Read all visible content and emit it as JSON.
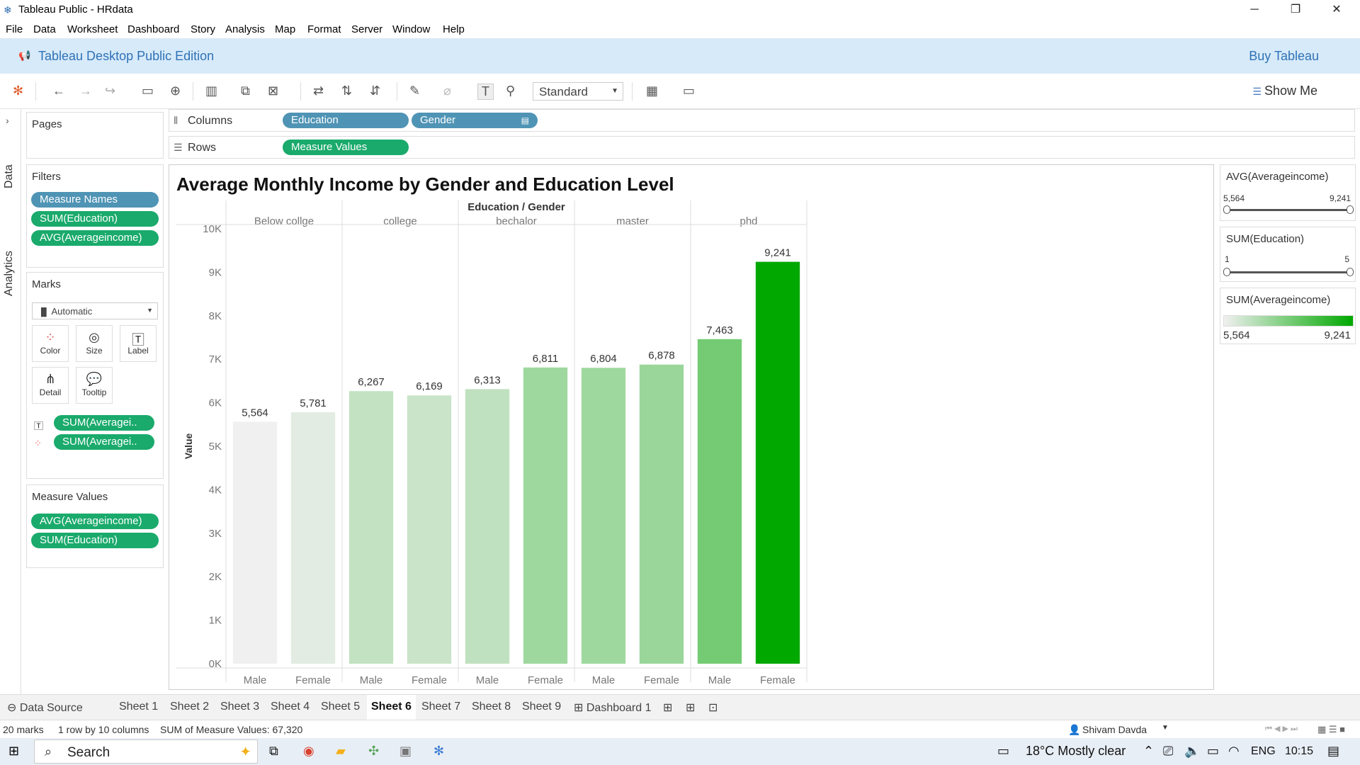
{
  "window": {
    "title": "Tableau Public - HRdata"
  },
  "menu": [
    "File",
    "Data",
    "Worksheet",
    "Dashboard",
    "Story",
    "Analysis",
    "Map",
    "Format",
    "Server",
    "Window",
    "Help"
  ],
  "banner": {
    "edition": "Tableau Desktop Public Edition",
    "buy": "Buy Tableau"
  },
  "toolbar": {
    "fit": "Standard",
    "show_me": "Show Me"
  },
  "left_tabs": {
    "data": "Data",
    "analytics": "Analytics"
  },
  "pages": {
    "header": "Pages"
  },
  "filters": {
    "header": "Filters",
    "items": [
      "Measure Names",
      "SUM(Education)",
      "AVG(Averageincome)"
    ]
  },
  "marks": {
    "header": "Marks",
    "type": "Automatic",
    "cards": {
      "color": "Color",
      "size": "Size",
      "label": "Label",
      "detail": "Detail",
      "tooltip": "Tooltip"
    },
    "fields": [
      "SUM(Averagei..",
      "SUM(Averagei.."
    ]
  },
  "measure_values": {
    "header": "Measure Values",
    "items": [
      "AVG(Averageincome)",
      "SUM(Education)"
    ]
  },
  "shelves": {
    "columns_label": "Columns",
    "columns": [
      "Education",
      "Gender"
    ],
    "rows_label": "Rows",
    "rows": [
      "Measure Values"
    ]
  },
  "chart_data": {
    "type": "bar",
    "title": "Average Monthly Income by Gender and Education Level",
    "header": "Education / Gender",
    "ylabel": "Value",
    "ylim": [
      0,
      10000
    ],
    "yticks": [
      "0K",
      "1K",
      "2K",
      "3K",
      "4K",
      "5K",
      "6K",
      "7K",
      "8K",
      "9K",
      "10K"
    ],
    "groups": [
      "Below collge",
      "college",
      "bechalor",
      "master",
      "phd"
    ],
    "categories": [
      "Male",
      "Female",
      "Male",
      "Female",
      "Male",
      "Female",
      "Male",
      "Female",
      "Male",
      "Female"
    ],
    "values": [
      5564,
      5781,
      6267,
      6169,
      6313,
      6811,
      6804,
      6878,
      7463,
      9241
    ],
    "labels": [
      "5,564",
      "5,781",
      "6,267",
      "6,169",
      "6,313",
      "6,811",
      "6,804",
      "6,878",
      "7,463",
      "9,241"
    ],
    "color_scale": {
      "min_color": "#f0f0f0",
      "max_color": "#00a800",
      "min": 5564,
      "max": 9241
    },
    "grid": false
  },
  "legends": {
    "avg": {
      "title": "AVG(Averageincome)",
      "min": "5,564",
      "max": "9,241"
    },
    "edu": {
      "title": "SUM(Education)",
      "min": "1",
      "max": "5"
    },
    "color": {
      "title": "SUM(Averageincome)",
      "min": "5,564",
      "max": "9,241"
    }
  },
  "sheets": [
    "Data Source",
    "Sheet 1",
    "Sheet 2",
    "Sheet 3",
    "Sheet 4",
    "Sheet 5",
    "Sheet 6",
    "Sheet 7",
    "Sheet 8",
    "Sheet 9",
    "Dashboard 1"
  ],
  "active_sheet": "Sheet 6",
  "status": {
    "marks": "20 marks",
    "rows": "1 row by 10 columns",
    "sum": "SUM of Measure Values: 67,320",
    "user": "Shivam Davda"
  },
  "taskbar": {
    "search": "Search",
    "weather": "18°C  Mostly clear",
    "lang": "ENG",
    "time": "10:15"
  }
}
